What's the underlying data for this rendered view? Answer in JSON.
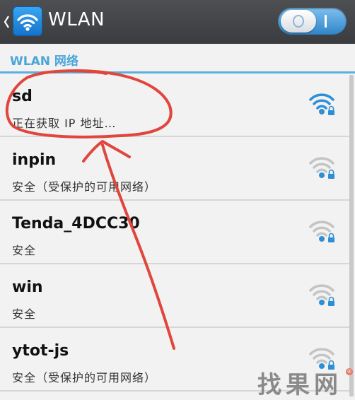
{
  "header": {
    "title": "WLAN",
    "toggle_on": true,
    "accent": "#2f85c9"
  },
  "section": {
    "label": "WLAN 网络"
  },
  "networks": [
    {
      "name": "sd",
      "status": "正在获取 IP 地址…",
      "signal": "strong",
      "locked": true,
      "icon_color": "#2d8fd6"
    },
    {
      "name": "inpin",
      "status": "安全（受保护的可用网络）",
      "signal": "weak",
      "locked": true,
      "icon_color": "#bdbdbd"
    },
    {
      "name": "Tenda_4DCC30",
      "status": "安全",
      "signal": "weak",
      "locked": true,
      "icon_color": "#bdbdbd"
    },
    {
      "name": "win",
      "status": "安全",
      "signal": "weak",
      "locked": true,
      "icon_color": "#bdbdbd"
    },
    {
      "name": "ytot-js",
      "status": "安全（受保护的可用网络）",
      "signal": "weak",
      "locked": true,
      "icon_color": "#bdbdbd"
    }
  ],
  "watermark": {
    "text": "找果网",
    "reg_mark": "®"
  },
  "annotation_color": "#e0463c"
}
